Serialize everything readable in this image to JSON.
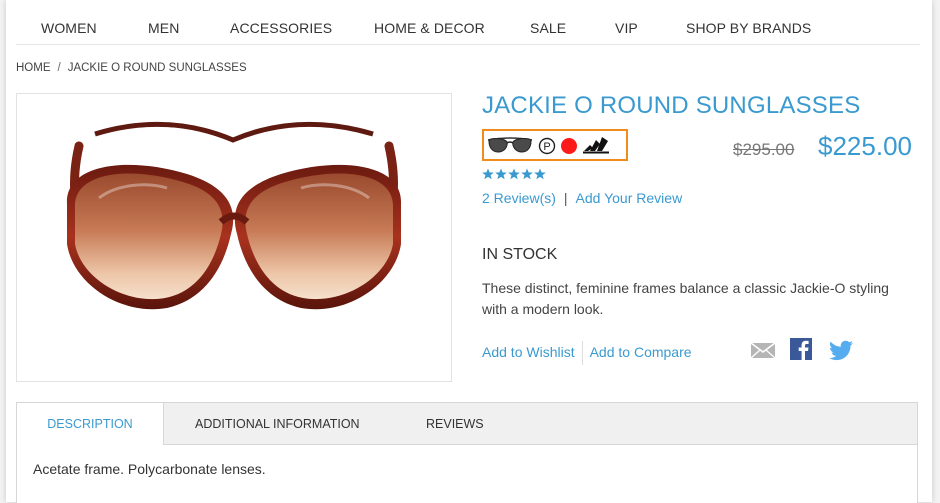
{
  "nav": {
    "items": [
      "WOMEN",
      "MEN",
      "ACCESSORIES",
      "HOME & DECOR",
      "SALE",
      "VIP",
      "SHOP BY BRANDS"
    ]
  },
  "breadcrumb": {
    "home": "HOME",
    "separator": "/",
    "current": "JACKIE O ROUND SUNGLASSES"
  },
  "product": {
    "title": "JACKIE O ROUND SUNGLASSES",
    "old_price": "$295.00",
    "special_price": "$225.00",
    "rating_stars": 5,
    "reviews_link": "2 Review(s)",
    "reviews_separator": "|",
    "add_review_link": "Add Your Review",
    "stock_status": "IN STOCK",
    "short_description": "These distinct, feminine frames balance a classic Jackie-O styling with a modern look.",
    "add_to_wishlist": "Add to Wishlist",
    "add_to_compare": "Add to Compare",
    "swatch_icons": [
      "sunglasses-icon",
      "p-logo-icon",
      "red-dot-icon",
      "three-stripes-logo-icon"
    ],
    "share_icons": [
      "email-icon",
      "facebook-icon",
      "twitter-icon"
    ]
  },
  "tabs": {
    "items": [
      "DESCRIPTION",
      "ADDITIONAL INFORMATION",
      "REVIEWS"
    ],
    "active": "DESCRIPTION",
    "content": "Acetate frame. Polycarbonate lenses."
  },
  "colors": {
    "accent": "#3a9ad0",
    "highlight_border": "#f08b1d",
    "swatch_red": "#ff1a1a",
    "facebook": "#3b5998",
    "twitter": "#55acee"
  }
}
